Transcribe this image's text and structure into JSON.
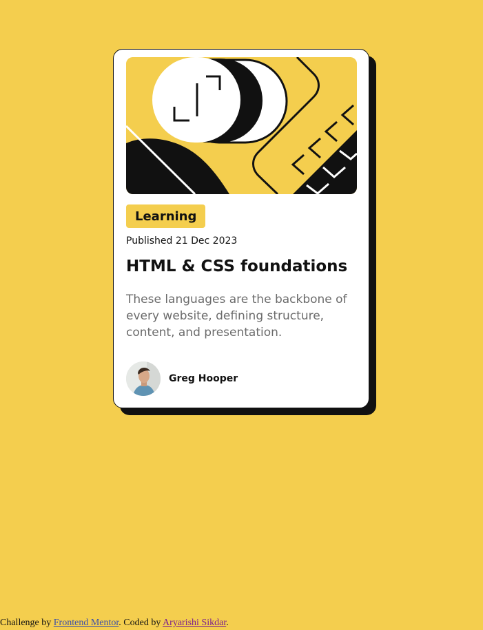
{
  "card": {
    "tag": "Learning",
    "published": "Published 21 Dec 2023",
    "title": "HTML & CSS foundations",
    "description": "These languages are the backbone of every website, defining structure, content, and presentation.",
    "author_name": "Greg Hooper"
  },
  "footer": {
    "prefix": "Challenge by ",
    "challenge_link": "Frontend Mentor",
    "middle": ". Coded by ",
    "author_link": "Aryarishi Sikdar",
    "suffix": "."
  },
  "colors": {
    "background": "#F4CE4E",
    "card": "#FFFFFF",
    "ink": "#111111",
    "muted_text": "#6B6B6B"
  },
  "icons": {
    "hero": "abstract-illustration",
    "avatar": "author-photo"
  }
}
